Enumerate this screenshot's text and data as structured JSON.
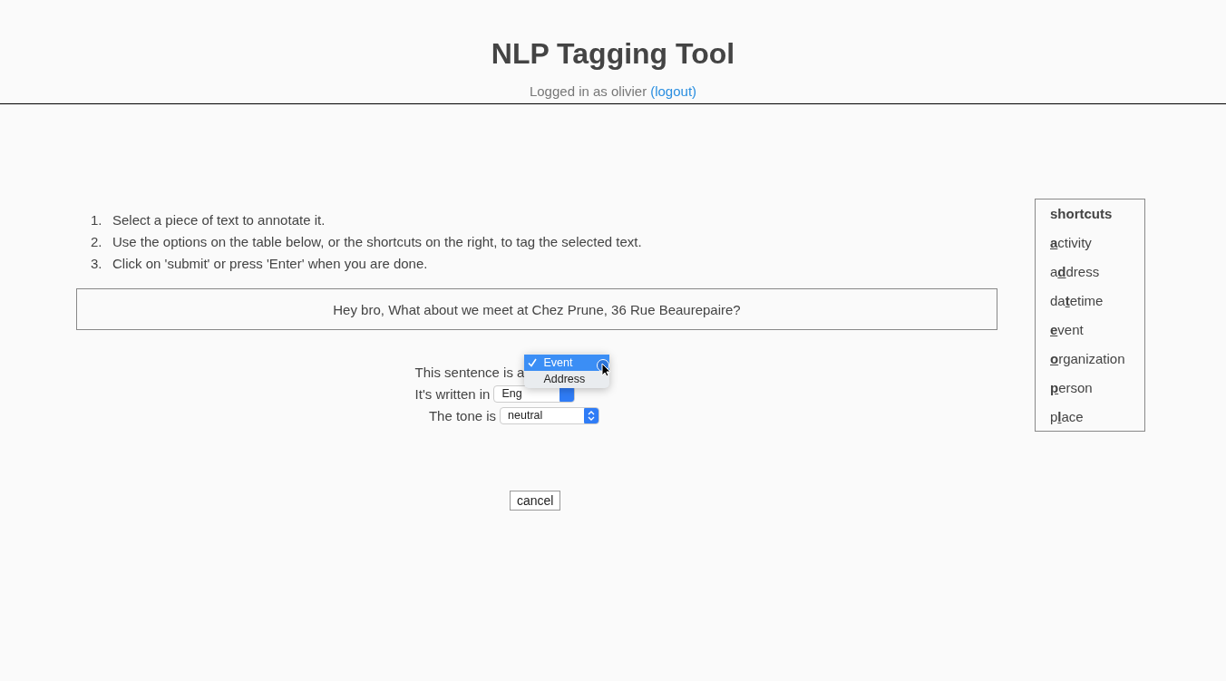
{
  "header": {
    "title": "NLP Tagging Tool",
    "login_text": "Logged in as olivier",
    "logout_link": "(logout)"
  },
  "instructions": [
    {
      "marker": "1.",
      "text": "Select a piece of text to annotate it."
    },
    {
      "marker": "2.",
      "text": "Use the options on the table below, or the shortcuts on the right, to tag the selected text."
    },
    {
      "marker": "3.",
      "text": "Click on 'submit' or press 'Enter' when you are done."
    }
  ],
  "sentence": "Hey bro, What about we meet at Chez Prune, 36 Rue Beaurepaire?",
  "form": {
    "type_label": "This sentence is a",
    "type_options": [
      {
        "label": "Event",
        "selected": true
      },
      {
        "label": "Address",
        "selected": false
      }
    ],
    "language_label": "It's written in",
    "language_value": "Eng",
    "tone_label": "The tone is",
    "tone_value": "neutral"
  },
  "cancel_button": "cancel",
  "shortcuts": {
    "title": "shortcuts",
    "items": [
      {
        "key": "a",
        "after": "ctivity"
      },
      {
        "before": "a",
        "key": "d",
        "after": "dress"
      },
      {
        "before": "da",
        "key": "t",
        "after": "etime"
      },
      {
        "key": "e",
        "after": "vent"
      },
      {
        "key": "o",
        "after": "rganization"
      },
      {
        "key": "p",
        "after": "erson"
      },
      {
        "before": "p",
        "key": "l",
        "after": "ace"
      }
    ]
  }
}
